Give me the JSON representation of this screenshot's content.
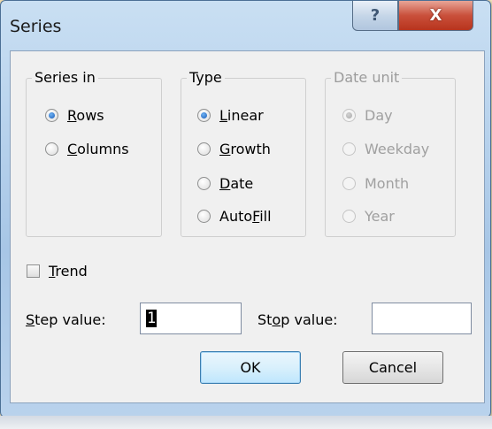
{
  "window": {
    "title": "Series",
    "help_glyph": "?",
    "close_glyph": "X"
  },
  "series_in": {
    "title": "Series in",
    "options": [
      {
        "label_pre": "",
        "label_ul": "R",
        "label_post": "ows",
        "checked": true
      },
      {
        "label_pre": "",
        "label_ul": "C",
        "label_post": "olumns",
        "checked": false
      }
    ]
  },
  "type": {
    "title": "Type",
    "options": [
      {
        "label_pre": "",
        "label_ul": "L",
        "label_post": "inear",
        "checked": true
      },
      {
        "label_pre": "",
        "label_ul": "G",
        "label_post": "rowth",
        "checked": false
      },
      {
        "label_pre": "",
        "label_ul": "D",
        "label_post": "ate",
        "checked": false
      },
      {
        "label_pre": "Auto",
        "label_ul": "F",
        "label_post": "ill",
        "checked": false
      }
    ]
  },
  "date_unit": {
    "title": "Date unit",
    "options": [
      {
        "label": "Day",
        "checked": true
      },
      {
        "label": "Weekday",
        "checked": false
      },
      {
        "label": "Month",
        "checked": false
      },
      {
        "label": "Year",
        "checked": false
      }
    ]
  },
  "trend": {
    "label_ul": "T",
    "label_post": "rend",
    "checked": false
  },
  "step": {
    "label_ul": "S",
    "label_post": "tep value:",
    "value": "1"
  },
  "stop": {
    "label_pre": "St",
    "label_ul": "o",
    "label_post": "p value:",
    "value": ""
  },
  "buttons": {
    "ok": "OK",
    "cancel": "Cancel"
  }
}
